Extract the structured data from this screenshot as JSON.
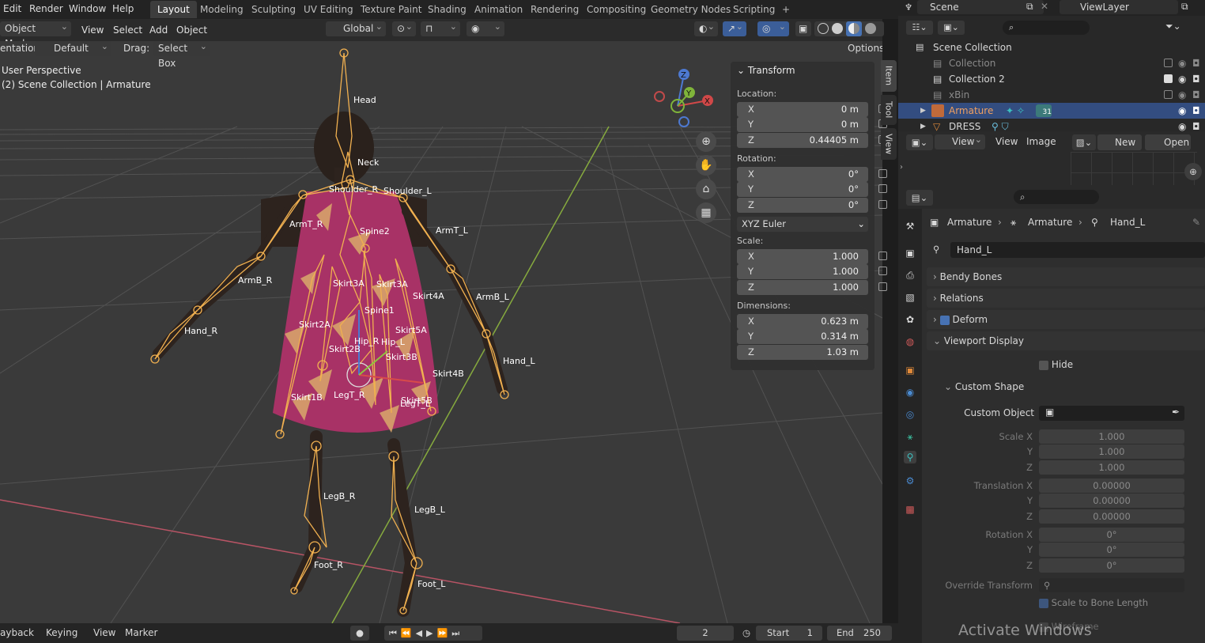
{
  "menu": {
    "edit": "Edit",
    "render": "Render",
    "window": "Window",
    "help": "Help"
  },
  "workspaces": [
    "Layout",
    "Modeling",
    "Sculpting",
    "UV Editing",
    "Texture Paint",
    "Shading",
    "Animation",
    "Rendering",
    "Compositing",
    "Geometry Nodes",
    "Scripting",
    "+"
  ],
  "header": {
    "mode": "Object Mode",
    "view": "View",
    "select": "Select",
    "add": "Add",
    "object": "Object",
    "orientation": "Global"
  },
  "toolsettings": {
    "orientation_label": "entation:",
    "orientation_value": "Default",
    "drag_label": "Drag:",
    "drag_value": "Select Box",
    "options": "Options"
  },
  "viewport": {
    "perspective": "User Perspective",
    "context": "(2) Scene Collection | Armature"
  },
  "bones": [
    "Head",
    "Neck",
    "Shoulder_R",
    "Shoulder_L",
    "ArmT_R",
    "ArmT_L",
    "Spine2",
    "ArmB_R",
    "ArmB_L",
    "Skirt3A",
    "Skirt3A",
    "Skirt4A",
    "Hand_R",
    "Hand_L",
    "Skirt2A",
    "Spine1",
    "Skirt5A",
    "Hip_R",
    "Hip_L",
    "Skirt2B",
    "Skirt3B",
    "Skirt4B",
    "Skirt1B",
    "LegT_R",
    "Skirt5B",
    "LegT_L",
    "LegB_R",
    "LegB_L",
    "Foot_R",
    "Foot_L"
  ],
  "npanel": {
    "title": "Transform",
    "location_label": "Location:",
    "location": [
      {
        "k": "X",
        "v": "0 m"
      },
      {
        "k": "Y",
        "v": "0 m"
      },
      {
        "k": "Z",
        "v": "0.44405 m"
      }
    ],
    "rotation_label": "Rotation:",
    "rotation": [
      {
        "k": "X",
        "v": "0°"
      },
      {
        "k": "Y",
        "v": "0°"
      },
      {
        "k": "Z",
        "v": "0°"
      }
    ],
    "rotation_mode": "XYZ Euler",
    "scale_label": "Scale:",
    "scale": [
      {
        "k": "X",
        "v": "1.000"
      },
      {
        "k": "Y",
        "v": "1.000"
      },
      {
        "k": "Z",
        "v": "1.000"
      }
    ],
    "dimensions_label": "Dimensions:",
    "dimensions": [
      {
        "k": "X",
        "v": "0.623 m"
      },
      {
        "k": "Y",
        "v": "0.314 m"
      },
      {
        "k": "Z",
        "v": "1.03 m"
      }
    ]
  },
  "side_tabs": [
    "Item",
    "Tool",
    "View"
  ],
  "timeline": {
    "playback": "ayback",
    "keying": "Keying",
    "view": "View",
    "marker": "Marker",
    "current": "2",
    "start_label": "Start",
    "start": "1",
    "end_label": "End",
    "end": "250"
  },
  "outliner": {
    "scene": "Scene",
    "viewlayer": "ViewLayer",
    "rows": [
      {
        "name": "Scene Collection"
      },
      {
        "name": "Collection"
      },
      {
        "name": "Collection 2"
      },
      {
        "name": "xBin"
      },
      {
        "name": "Armature",
        "extra": "31"
      },
      {
        "name": "DRESS"
      }
    ]
  },
  "imgedit": {
    "view": "View",
    "view2": "View",
    "image": "Image",
    "new": "New",
    "open": "Open"
  },
  "props": {
    "bc1": "Armature",
    "bc2": "Armature",
    "bc3": "Hand_L",
    "bone_name": "Hand_L",
    "sections": [
      "Bendy Bones",
      "Relations",
      "Deform",
      "Viewport Display"
    ],
    "hide": "Hide",
    "custom_shape": "Custom Shape",
    "custom_object": "Custom Object",
    "fields": [
      {
        "label": "Scale X",
        "value": "1.000"
      },
      {
        "label": "Y",
        "value": "1.000"
      },
      {
        "label": "Z",
        "value": "1.000"
      },
      {
        "label": "Translation X",
        "value": "0.00000"
      },
      {
        "label": "Y",
        "value": "0.00000"
      },
      {
        "label": "Z",
        "value": "0.00000"
      },
      {
        "label": "Rotation X",
        "value": "0°"
      },
      {
        "label": "Y",
        "value": "0°"
      },
      {
        "label": "Z",
        "value": "0°"
      }
    ],
    "override_transform": "Override Transform",
    "scale_bone": "Scale to Bone Length",
    "wireframe": "Wireframe"
  },
  "watermark": "Activate Windows",
  "colors": {
    "accent": "#4772b3",
    "bone": "#f0b050",
    "grid": "#5a5a5a",
    "xaxis": "#c0535f",
    "yaxis": "#8eb44a"
  }
}
